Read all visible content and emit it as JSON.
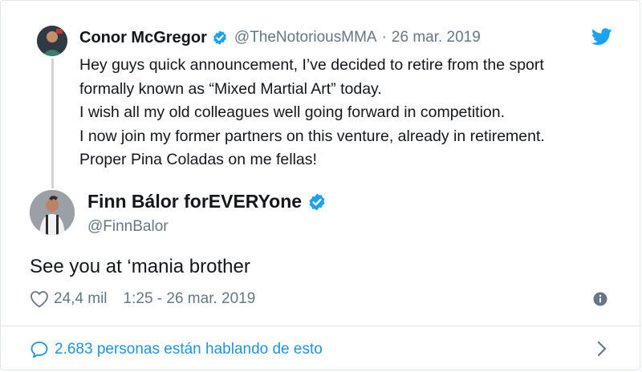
{
  "parent": {
    "name": "Conor McGregor",
    "handle": "@TheNotoriousMMA",
    "separator": "·",
    "date": "26 mar. 2019",
    "lines": [
      "Hey guys quick announcement, I’ve decided to retire from the sport",
      "formally known as “Mixed Martial Art” today.",
      "I wish all my old colleagues well going forward in competition.",
      "I now join my former partners on this venture, already in retirement.",
      "Proper Pina Coladas on me fellas!"
    ]
  },
  "reply": {
    "name": "Finn Bálor forEVERYone",
    "handle": "@FinnBalor",
    "text": "See you at ‘mania brother",
    "likes": "24,4 mil",
    "timestamp": "1:25 - 26 mar. 2019"
  },
  "footer": {
    "talking": "2.683 personas están hablando de esto"
  },
  "icons": {
    "verified": "verified-badge-icon",
    "brand": "twitter-bird-icon",
    "like": "heart-icon",
    "info": "info-icon",
    "talking": "speech-bubble-icon",
    "more": "chevron-right-icon"
  },
  "colors": {
    "verified": "#1da1f2",
    "link": "#1b95e0",
    "muted": "#657786",
    "thread": "#ccd6dd"
  }
}
